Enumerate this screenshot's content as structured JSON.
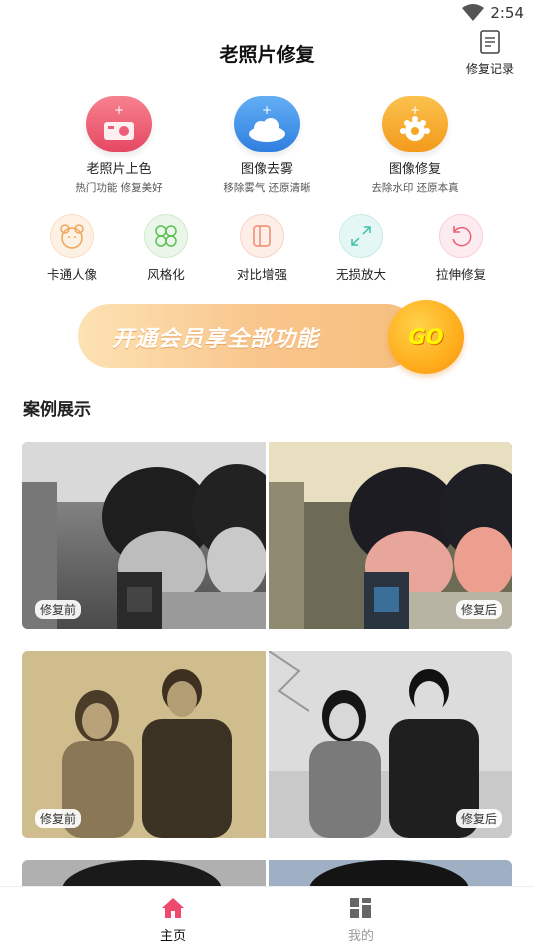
{
  "status": {
    "time": "2:54"
  },
  "header": {
    "title": "老照片修复",
    "history_label": "修复记录"
  },
  "features": [
    {
      "name": "老照片上色",
      "desc": "热门功能  修复美好",
      "color": "#ee5d77"
    },
    {
      "name": "图像去雾",
      "desc": "移除雾气  还原清晰",
      "color": "#3f8de8"
    },
    {
      "name": "图像修复",
      "desc": "去除水印  还原本真",
      "color": "#f6a825"
    }
  ],
  "tools": [
    {
      "name": "卡通人像",
      "color": "#f7c58e"
    },
    {
      "name": "风格化",
      "color": "#8ccf87"
    },
    {
      "name": "对比增强",
      "color": "#f3a58b"
    },
    {
      "name": "无损放大",
      "color": "#6fd2c6"
    },
    {
      "name": "拉伸修复",
      "color": "#ef7f8f"
    }
  ],
  "banner": {
    "text": "开通会员享全部功能",
    "go": "GO"
  },
  "section": {
    "title": "案例展示"
  },
  "cases": [
    {
      "before": "修复前",
      "after": "修复后"
    },
    {
      "before": "修复前",
      "after": "修复后"
    }
  ],
  "nav": [
    {
      "label": "主页",
      "active": true
    },
    {
      "label": "我的",
      "active": false
    }
  ],
  "colors": {
    "accent": "#ef4a6e"
  }
}
